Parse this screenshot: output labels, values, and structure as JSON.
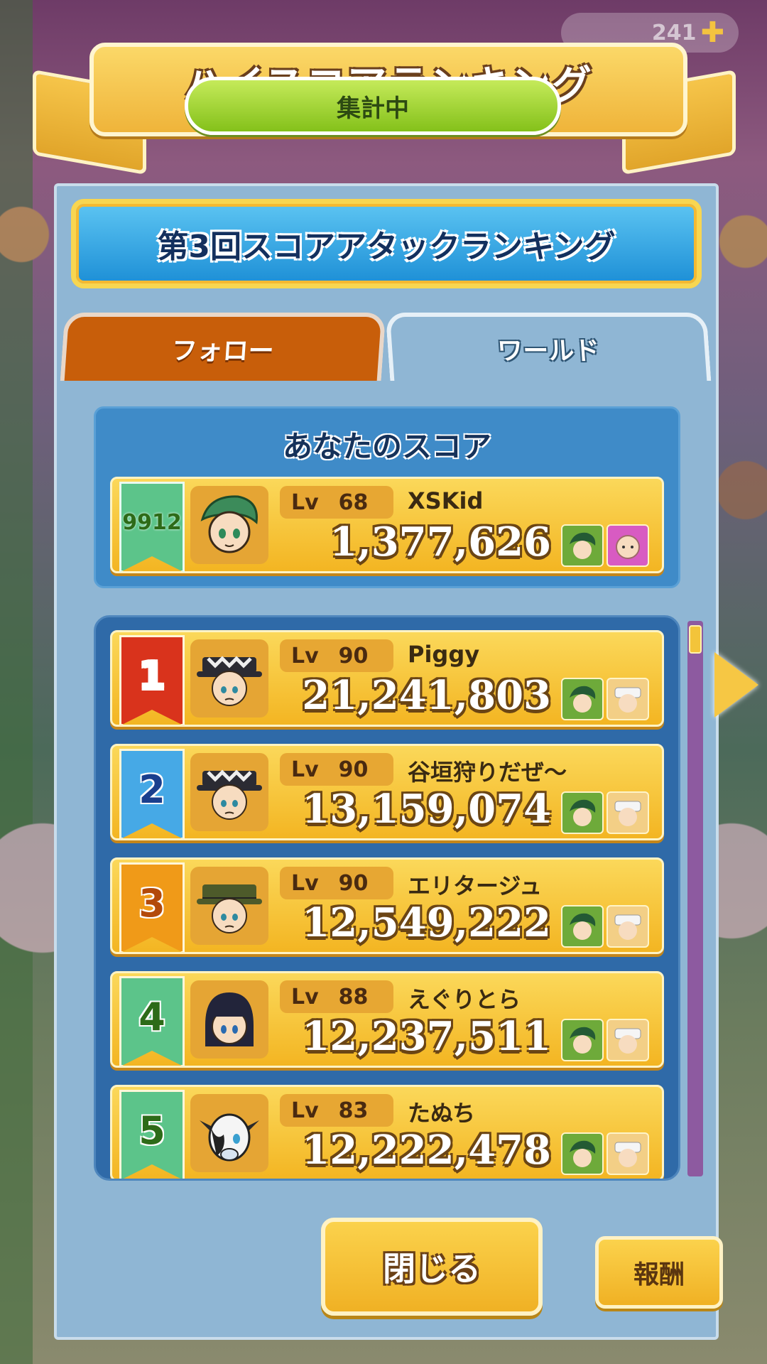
{
  "header": {
    "title": "ハイスコアランキング",
    "status": "集計中",
    "coins_partial": "241"
  },
  "event": {
    "title": "第3回スコアアタックランキング"
  },
  "tabs": [
    {
      "label": "フォロー",
      "active": false
    },
    {
      "label": "ワールド",
      "active": true
    }
  ],
  "my_score": {
    "label": "あなたのスコア",
    "rank": "9912",
    "lv_label": "Lv",
    "level": "68",
    "name": "XSKid",
    "score": "1,377,626"
  },
  "rankings": [
    {
      "rank": "1",
      "lv_label": "Lv",
      "level": "90",
      "name": "Piggy",
      "score": "21,241,803",
      "rank_color": "#d9331c",
      "rank_text_color": "#ffffff"
    },
    {
      "rank": "2",
      "lv_label": "Lv",
      "level": "90",
      "name": "谷垣狩りだぜ〜",
      "score": "13,159,074",
      "rank_color": "#46a9e6",
      "rank_text_color": "#1a3f8e"
    },
    {
      "rank": "3",
      "lv_label": "Lv",
      "level": "90",
      "name": "エリタージュ",
      "score": "12,549,222",
      "rank_color": "#f09a18",
      "rank_text_color": "#b34a0a"
    },
    {
      "rank": "4",
      "lv_label": "Lv",
      "level": "88",
      "name": "えぐりとら",
      "score": "12,237,511",
      "rank_color": "#5cc48a",
      "rank_text_color": "#2d6b18"
    },
    {
      "rank": "5",
      "lv_label": "Lv",
      "level": "83",
      "name": "たぬち",
      "score": "12,222,478",
      "rank_color": "#5cc48a",
      "rank_text_color": "#2d6b18"
    }
  ],
  "buttons": {
    "close": "閉じる",
    "reward": "報酬"
  }
}
